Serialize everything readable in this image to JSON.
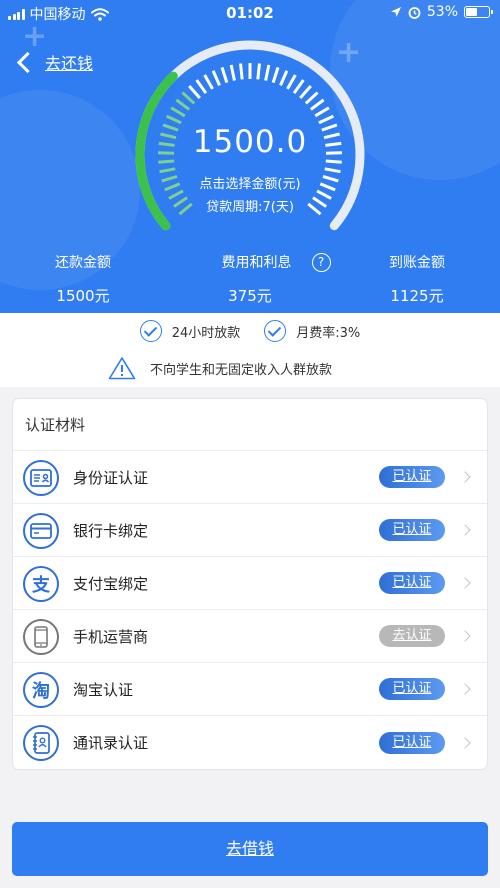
{
  "status_bar": {
    "carrier": "中国移动",
    "time": "01:02",
    "battery": "53%",
    "battery_level": 0.53,
    "icons": [
      "signal-icon",
      "wifi-icon",
      "location-icon",
      "alarm-icon",
      "battery-icon"
    ]
  },
  "header": {
    "back_label": "去还钱"
  },
  "gauge": {
    "amount": "1500.0",
    "hint": "点击选择金额(元)",
    "period": "贷款周期:7(天)",
    "fill_fraction": 0.33
  },
  "summary": [
    {
      "label": "还款金额",
      "value": "1500元"
    },
    {
      "label": "费用和利息",
      "value": "375元",
      "has_help": true
    },
    {
      "label": "到账金额",
      "value": "1125元"
    }
  ],
  "notice": {
    "items": [
      "24小时放款",
      "月费率:3%"
    ],
    "warning": "不向学生和无固定收入人群放款"
  },
  "card": {
    "title": "认证材料",
    "rows": [
      {
        "label": "身份证认证",
        "badge": "已认证",
        "icon": "id-card-icon",
        "verified": true
      },
      {
        "label": "银行卡绑定",
        "badge": "已认证",
        "icon": "bank-card-icon",
        "verified": true
      },
      {
        "label": "支付宝绑定",
        "badge": "已认证",
        "icon": "alipay-icon",
        "verified": true
      },
      {
        "label": "手机运营商",
        "badge": "去认证",
        "icon": "phone-icon",
        "verified": false
      },
      {
        "label": "淘宝认证",
        "badge": "已认证",
        "icon": "taobao-icon",
        "verified": true
      },
      {
        "label": "通讯录认证",
        "badge": "已认证",
        "icon": "contacts-icon",
        "verified": true
      }
    ]
  },
  "main_button": "去借钱",
  "colors": {
    "primary": "#2f7df0",
    "gauge_active": "#3cc24a",
    "badge_disabled": "#b8b8b8"
  }
}
